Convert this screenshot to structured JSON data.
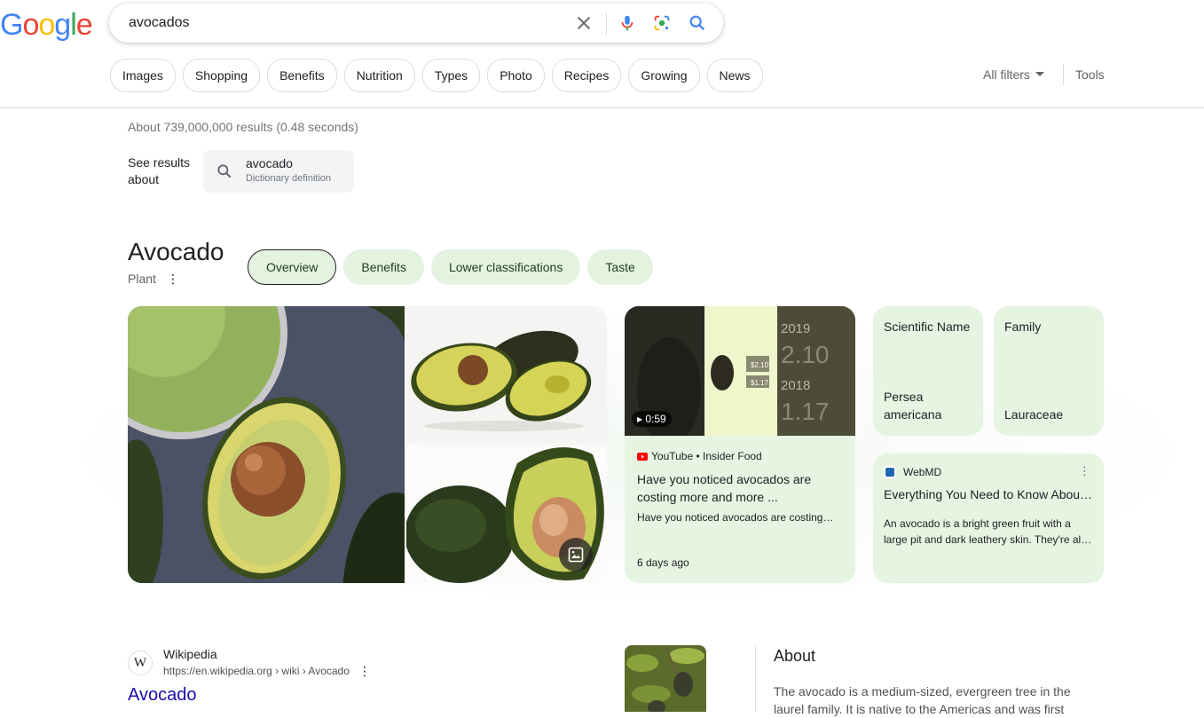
{
  "header": {
    "logo_text": "Google",
    "search_query": "avocados"
  },
  "chips": [
    "Images",
    "Shopping",
    "Benefits",
    "Nutrition",
    "Types",
    "Photo",
    "Recipes",
    "Growing",
    "News"
  ],
  "filters": {
    "all_filters": "All filters",
    "tools": "Tools"
  },
  "results_stats": "About 739,000,000 results (0.48 seconds)",
  "see_results_about": {
    "label": "See results about",
    "word": "avocado",
    "desc": "Dictionary definition"
  },
  "knowledge_panel": {
    "title": "Avocado",
    "subtitle": "Plant",
    "tabs": [
      "Overview",
      "Benefits",
      "Lower classifications",
      "Taste"
    ],
    "video": {
      "duration": "0:59",
      "thumb_labels": [
        "2019",
        "2.10",
        "2018",
        "1.17",
        "$2.10",
        "$1.17"
      ],
      "source": "YouTube • Insider Food",
      "title": "Have you noticed avocados are costing more and more ...",
      "desc": "Have you noticed avocados are costing…",
      "date": "6 days ago"
    },
    "facts": [
      {
        "label": "Scientific Name",
        "value": "Persea americana"
      },
      {
        "label": "Family",
        "value": "Lauraceae"
      }
    ],
    "webmd": {
      "source": "WebMD",
      "title": "Everything You Need to Know Abou…",
      "desc_line1": "An avocado is a bright green fruit with a",
      "desc_line2": "large pit and dark leathery skin. They're al…"
    }
  },
  "wiki_result": {
    "favicon": "W",
    "site": "Wikipedia",
    "url": "https://en.wikipedia.org › wiki › Avocado",
    "title": "Avocado"
  },
  "about": {
    "heading": "About",
    "text": "The avocado is a medium-sized, evergreen tree in the laurel family. It is native to the Americas and was first"
  },
  "colors": {
    "card_green": "#e6f4e2",
    "link_blue": "#1a0dab",
    "google_blue": "#4285f4",
    "google_red": "#ea4335",
    "google_yellow": "#fbbc05",
    "google_green": "#34a853"
  }
}
